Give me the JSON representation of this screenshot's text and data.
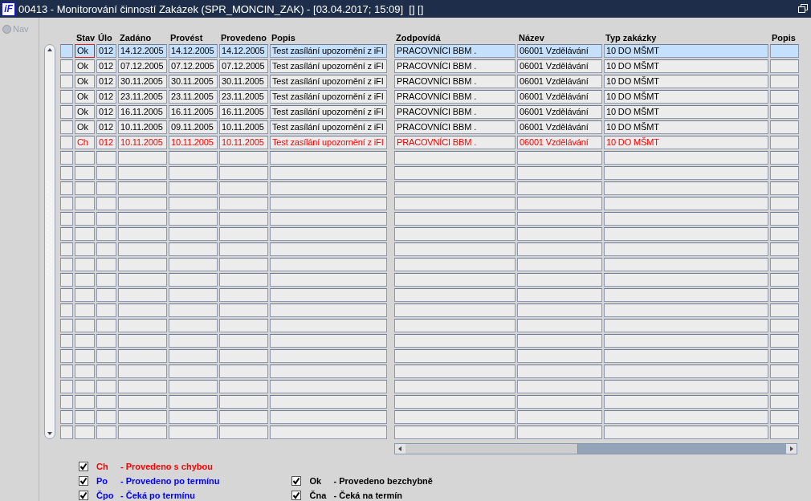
{
  "window": {
    "logo": "iF",
    "title": "00413 - Monitorování činností Zakázek (SPR_MONCIN_ZAK) - [03.04.2017; 15:09]  [] []"
  },
  "nav": {
    "label": "Nav",
    "disabled": true
  },
  "table": {
    "columns_left": [
      "Stav",
      "Úlo",
      "Zadáno",
      "Provést",
      "Provedeno",
      "Popis"
    ],
    "columns_right": [
      "Zodpovídá",
      "Název",
      "Typ zakázky",
      "Popis"
    ],
    "rows": [
      {
        "selected": true,
        "focused": true,
        "error": false,
        "cells": [
          "Ok",
          "012",
          "14.12.2005",
          "14.12.2005",
          "14.12.2005",
          "Test zasílání upozornění z iFI",
          "PRACOVNÍCI BBM .",
          "06001 Vzdělávání",
          "10 DO MŠMT"
        ]
      },
      {
        "selected": false,
        "focused": false,
        "error": false,
        "cells": [
          "Ok",
          "012",
          "07.12.2005",
          "07.12.2005",
          "07.12.2005",
          "Test zasílání upozornění z iFI",
          "PRACOVNÍCI BBM .",
          "06001 Vzdělávání",
          "10 DO MŠMT"
        ]
      },
      {
        "selected": false,
        "focused": false,
        "error": false,
        "cells": [
          "Ok",
          "012",
          "30.11.2005",
          "30.11.2005",
          "30.11.2005",
          "Test zasílání upozornění z iFI",
          "PRACOVNÍCI BBM .",
          "06001 Vzdělávání",
          "10 DO MŠMT"
        ]
      },
      {
        "selected": false,
        "focused": false,
        "error": false,
        "cells": [
          "Ok",
          "012",
          "23.11.2005",
          "23.11.2005",
          "23.11.2005",
          "Test zasílání upozornění z iFI",
          "PRACOVNÍCI BBM .",
          "06001 Vzdělávání",
          "10 DO MŠMT"
        ]
      },
      {
        "selected": false,
        "focused": false,
        "error": false,
        "cells": [
          "Ok",
          "012",
          "16.11.2005",
          "16.11.2005",
          "16.11.2005",
          "Test zasílání upozornění z iFI",
          "PRACOVNÍCI BBM .",
          "06001 Vzdělávání",
          "10 DO MŠMT"
        ]
      },
      {
        "selected": false,
        "focused": false,
        "error": false,
        "cells": [
          "Ok",
          "012",
          "10.11.2005",
          "09.11.2005",
          "10.11.2005",
          "Test zasílání upozornění z iFI",
          "PRACOVNÍCI BBM .",
          "06001 Vzdělávání",
          "10 DO MŠMT"
        ]
      },
      {
        "selected": false,
        "focused": false,
        "error": true,
        "cells": [
          "Ch",
          "012",
          "10.11.2005",
          "10.11.2005",
          "10.11.2005",
          "Test zasílání upozornění z iFI",
          "PRACOVNÍCI BBM .",
          "06001 Vzdělávání",
          "10 DO MŠMT"
        ]
      }
    ]
  },
  "legend_left": [
    {
      "code": "Ch",
      "label": "- Provedeno s chybou",
      "checked": true,
      "color": "#ff0000"
    },
    {
      "code": "Po",
      "label": "- Provedeno po termínu",
      "checked": true,
      "color": "#0000ff"
    },
    {
      "code": "Čpo",
      "label": "- Čeká po termínu",
      "checked": true,
      "color": "#0000ff"
    }
  ],
  "legend_right": [
    {
      "code": "Ok",
      "label": "- Provedeno bezchybně",
      "checked": true,
      "color": "#000000"
    },
    {
      "code": "Čna",
      "label": "- Čeká na termín",
      "checked": true,
      "color": "#000000"
    }
  ]
}
